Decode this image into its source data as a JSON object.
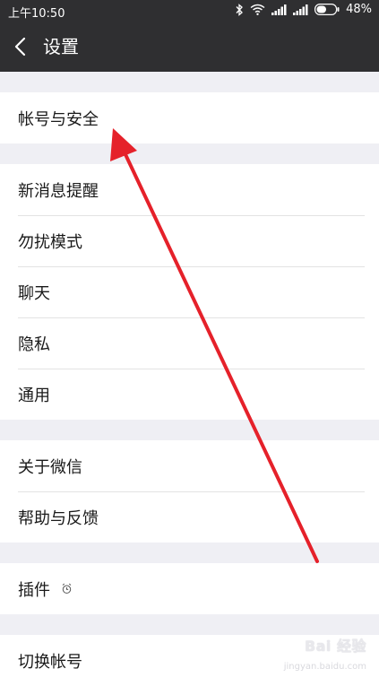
{
  "statusbar": {
    "time": "上午10:50",
    "battery": "48%"
  },
  "header": {
    "title": "设置"
  },
  "groups": [
    {
      "items": [
        {
          "label": "帐号与安全"
        }
      ]
    },
    {
      "items": [
        {
          "label": "新消息提醒"
        },
        {
          "label": "勿扰模式"
        },
        {
          "label": "聊天"
        },
        {
          "label": "隐私"
        },
        {
          "label": "通用"
        }
      ]
    },
    {
      "items": [
        {
          "label": "关于微信"
        },
        {
          "label": "帮助与反馈"
        }
      ]
    },
    {
      "items": [
        {
          "label": "插件"
        }
      ]
    },
    {
      "items": [
        {
          "label": "切换帐号"
        }
      ]
    }
  ],
  "annotation": {
    "arrow_color": "#e5212a"
  },
  "watermark": {
    "text": "Bai 经验",
    "sub": "jingyan.baidu.com"
  }
}
